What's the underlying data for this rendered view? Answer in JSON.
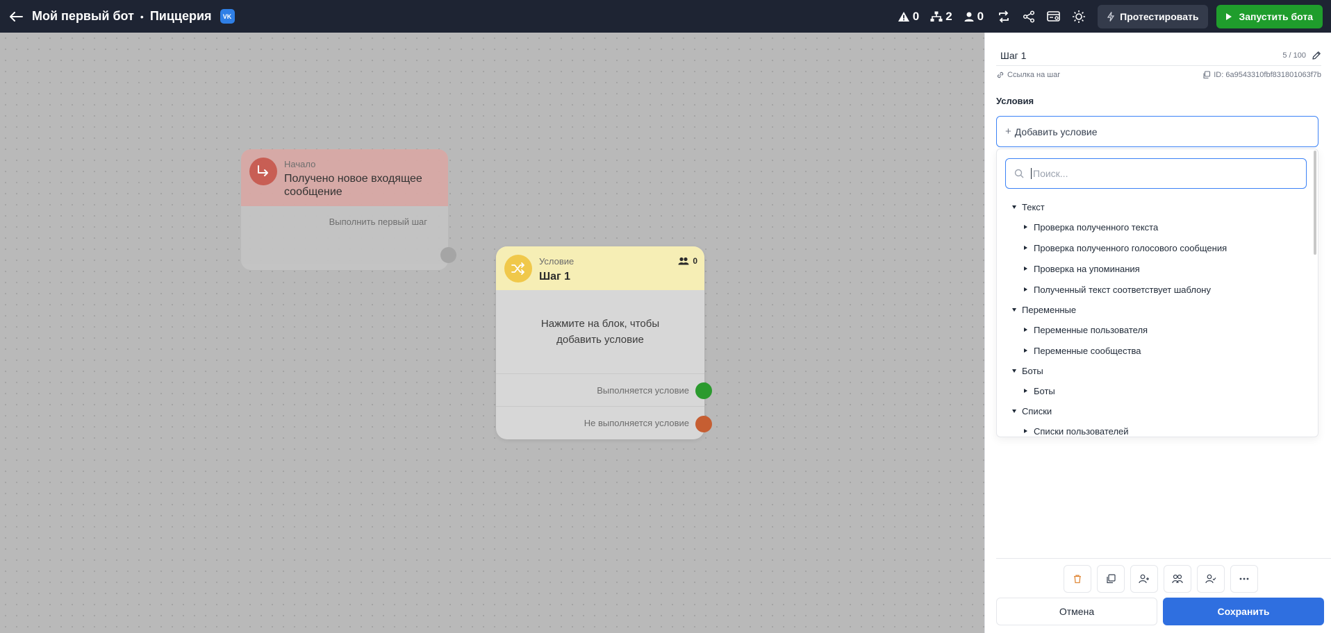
{
  "header": {
    "bot_name": "Мой первый бот",
    "separator": "•",
    "project_name": "Пиццерия",
    "vk_badge": "VK",
    "stats": {
      "warnings": "0",
      "steps": "2",
      "users": "0"
    },
    "test_label": "Протестировать",
    "run_label": "Запустить бота"
  },
  "canvas": {
    "start_node": {
      "kind": "Начало",
      "title": "Получено новое входящее сообщение",
      "output": "Выполнить первый шаг"
    },
    "condition_node": {
      "kind": "Условие",
      "title": "Шаг 1",
      "users_count": "0",
      "placeholder": "Нажмите на блок, чтобы добавить условие",
      "true_output": "Выполняется условие",
      "false_output": "Не выполняется условие"
    }
  },
  "panel": {
    "step_name": "Шаг 1",
    "char_count": "5 / 100",
    "step_link": "Ссылка на шаг",
    "step_id": "ID: 6a9543310fbf831801063f7b",
    "conditions_title": "Условия",
    "add_condition": "Добавить условие",
    "search_placeholder": "Поиск...",
    "tree": [
      {
        "label": "Текст",
        "items": [
          "Проверка полученного текста",
          "Проверка полученного голосового сообщения",
          "Проверка на упоминания",
          "Полученный текст соответствует шаблону"
        ]
      },
      {
        "label": "Переменные",
        "items": [
          "Переменные пользователя",
          "Переменные сообщества"
        ]
      },
      {
        "label": "Боты",
        "items": [
          "Боты"
        ]
      },
      {
        "label": "Списки",
        "items": [
          "Списки пользователей"
        ]
      }
    ],
    "cancel_label": "Отмена",
    "save_label": "Сохранить"
  },
  "colors": {
    "topbar": "#1e2433",
    "run_button": "#1f9d2c",
    "save_button": "#2f6fe0",
    "focus_border": "#3b82f6",
    "true_port": "#2b9a2e",
    "false_port": "#c65e32"
  }
}
